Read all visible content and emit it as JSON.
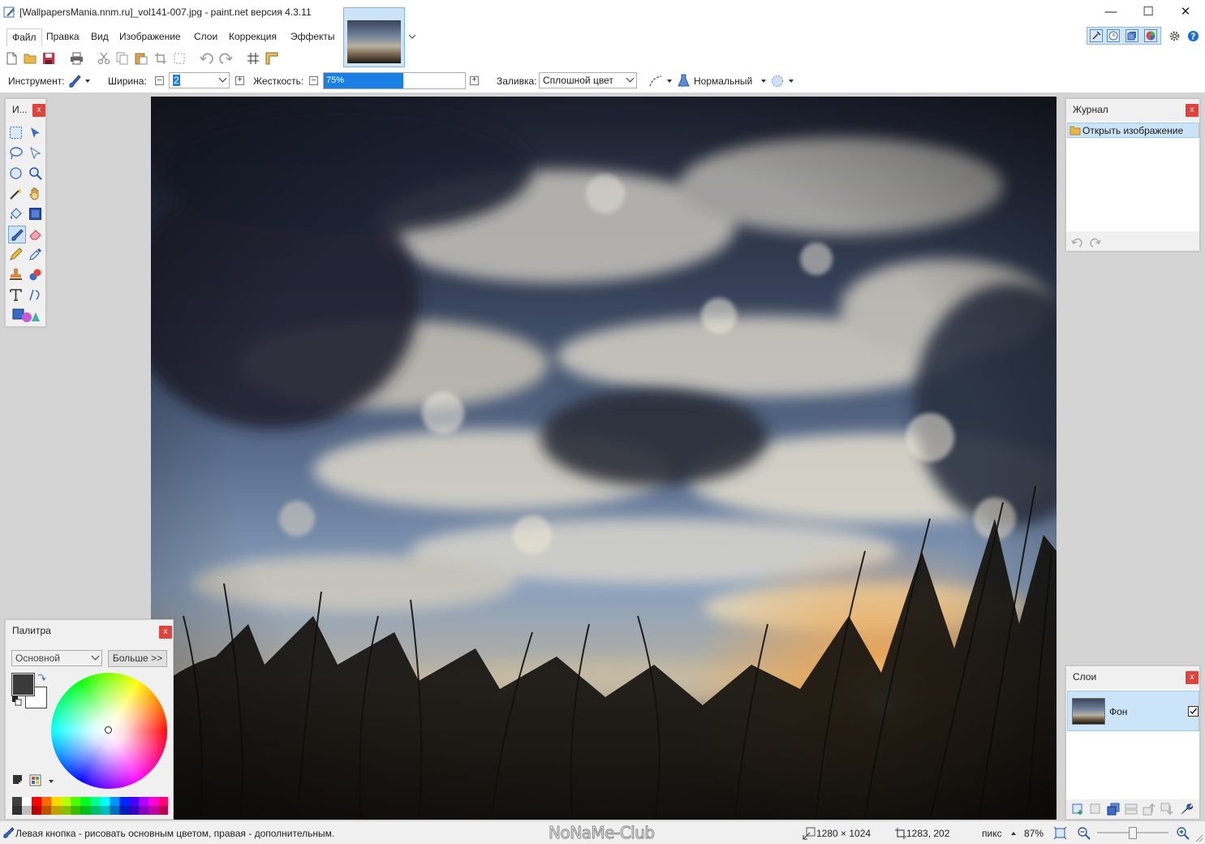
{
  "window": {
    "title": "[WallpapersMania.nnm.ru]_vol141-007.jpg - paint.net версия 4.3.11",
    "minimize": "—",
    "maximize": "☐",
    "close": "✕"
  },
  "menu": [
    "Файл",
    "Правка",
    "Вид",
    "Изображение",
    "Слои",
    "Коррекция",
    "Эффекты"
  ],
  "options": {
    "tool_label": "Инструмент:",
    "width_label": "Ширина:",
    "width_value": "2",
    "hardness_label": "Жесткость:",
    "hardness_value": "75%",
    "hardness_fraction": 0.75,
    "fill_label": "Заливка:",
    "fill_value": "Сплошной цвет",
    "blend_value": "Нормальный"
  },
  "tools_panel": {
    "title": "И...",
    "close": "x"
  },
  "history_panel": {
    "title": "Журнал",
    "close": "x",
    "items": [
      "Открыть изображение"
    ]
  },
  "layers_panel": {
    "title": "Слои",
    "close": "x",
    "layers": [
      {
        "name": "Фон",
        "visible": true
      }
    ]
  },
  "palette_panel": {
    "title": "Палитра",
    "close": "x",
    "mode": "Основной",
    "more_button": "Больше >>",
    "primary_color": "#3a3a3a",
    "secondary_color": "#ffffff",
    "swatches": [
      "#404040",
      "#ffffff",
      "#ff0000",
      "#ff6a00",
      "#ffd800",
      "#b6ff00",
      "#4cff00",
      "#00ff21",
      "#00ff90",
      "#00ffff",
      "#0094ff",
      "#0026ff",
      "#4800ff",
      "#b200ff",
      "#ff00dc",
      "#ff006e"
    ]
  },
  "status": {
    "hint": "Левая кнопка - рисовать основным цветом, правая - дополнительным.",
    "watermark": "NoNaMe-Club",
    "image_size": "1280 × 1024",
    "cursor_pos": "1283, 202",
    "units": "пикс",
    "zoom": "87%"
  },
  "colors": {
    "accent": "#1a80e5",
    "selection": "#cce4f7",
    "workspace": "#d4d4d4"
  }
}
